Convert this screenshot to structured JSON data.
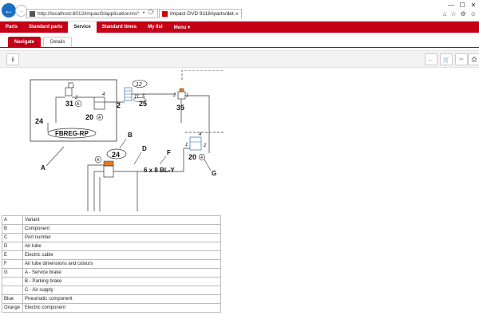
{
  "browser": {
    "url": "http://localhost:8012/impact3/application/#serv",
    "address_tools": "⌕ ▾ ⟳",
    "tab_title": "Impact DVD 9118#parts/det...",
    "tab_close": "×",
    "window_controls": [
      "—",
      "☐",
      "✕"
    ],
    "toolbar_icons": [
      "⌂",
      "☆",
      "⚙",
      "☺"
    ],
    "back_glyph": "←",
    "forward_glyph": "→"
  },
  "menu": {
    "items": [
      {
        "label": "Parts"
      },
      {
        "label": "Standard parts"
      },
      {
        "label": "Service"
      },
      {
        "label": "Standard times"
      },
      {
        "label": "My list"
      },
      {
        "label": "Menu ▾"
      }
    ]
  },
  "subtabs": {
    "navigate": "Navigate",
    "details": "Details"
  },
  "toolbar": {
    "info_glyph": "i",
    "back_glyph": "←",
    "cart_glyph": "🛒",
    "tool_glyph": "✂",
    "print_glyph": "⎙"
  },
  "diagram": {
    "labels": {
      "n1a": "1",
      "n2a": "2",
      "n31": "31",
      "nA1": "A",
      "n4a": "4",
      "n20a": "20",
      "nA2": "A",
      "n24a": "24",
      "fbreg": "FBREG-RP",
      "n12": "12",
      "n2b": "2",
      "n11": "11",
      "n5": "5",
      "n25": "25",
      "n2c": "2",
      "n1c": "1",
      "n35": "35",
      "lB": "B",
      "n24b": "24",
      "lD": "D",
      "lF": "F",
      "tube": "6 x 8 BL-Y",
      "lA": "A",
      "nA3": "A",
      "n4b": "4",
      "n1d": "1",
      "n2d": "2",
      "n20b": "20",
      "nA4": "A",
      "lG": "G"
    }
  },
  "legend": {
    "rows": [
      {
        "key": "A",
        "value": "Variant"
      },
      {
        "key": "B",
        "value": "Component"
      },
      {
        "key": "C",
        "value": "Port number"
      },
      {
        "key": "D",
        "value": "Air tube"
      },
      {
        "key": "E",
        "value": "Electric cable"
      },
      {
        "key": "F",
        "value": "Air tube dimensions and colours"
      },
      {
        "key": "G",
        "value": "A - Service brake"
      },
      {
        "key": "",
        "value": "B - Parking brake"
      },
      {
        "key": "",
        "value": "C - Air supply"
      },
      {
        "key": "Blue",
        "value": "Pneumatic component"
      },
      {
        "key": "Orange",
        "value": "Electric component"
      }
    ]
  },
  "colors": {
    "brand_red": "#c40017",
    "browser_blue": "#1a6fc0",
    "electric_orange": "#e07a2a"
  }
}
